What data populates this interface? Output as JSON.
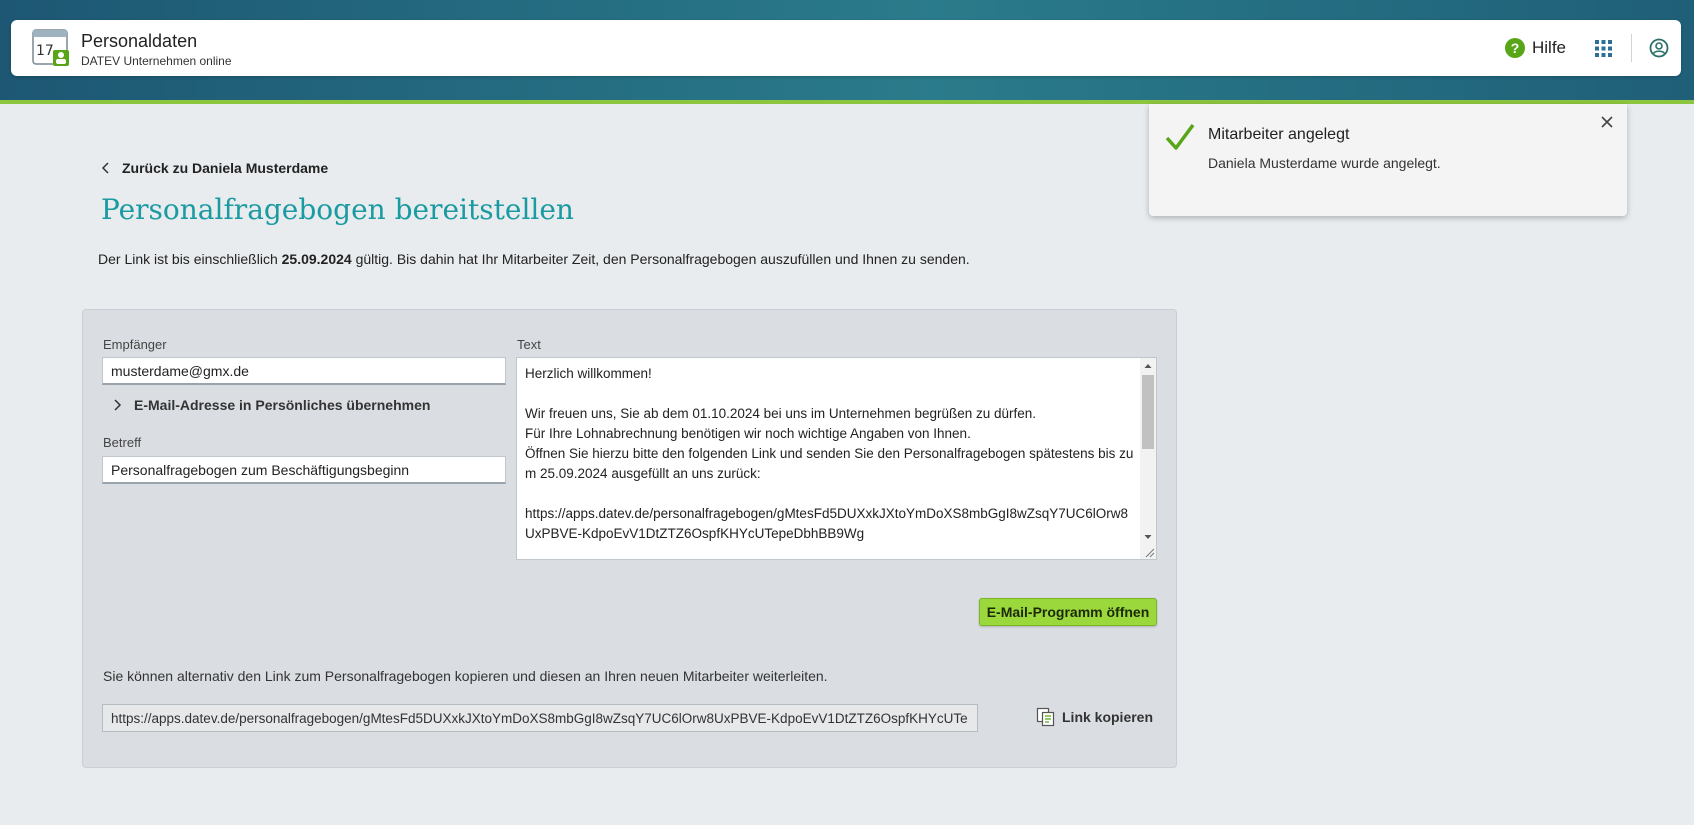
{
  "app": {
    "title": "Personaldaten",
    "subtitle": "DATEV Unternehmen online",
    "icon": "calendar-17-icon"
  },
  "header": {
    "help_label": "Hilfe",
    "help_icon_glyph": "?",
    "apps_icon": "grid-icon",
    "user_icon": "user-icon"
  },
  "toast": {
    "title": "Mitarbeiter angelegt",
    "message": "Daniela Musterdame wurde angelegt.",
    "icon": "check-icon",
    "close_icon": "close-icon"
  },
  "nav": {
    "back_label": "Zurück zu Daniela Musterdame"
  },
  "page": {
    "title": "Personalfragebogen bereitstellen",
    "info_prefix": "Der Link ist bis einschließlich ",
    "info_date": "25.09.2024",
    "info_suffix": " gültig. Bis dahin hat Ihr Mitarbeiter Zeit, den Personalfragebogen auszufüllen und Ihnen zu senden."
  },
  "form": {
    "recipient_label": "Empfänger",
    "recipient_value": "musterdame@gmx.de",
    "adopt_email_label": "E-Mail-Adresse in Persönliches übernehmen",
    "subject_label": "Betreff",
    "subject_value": "Personalfragebogen zum Beschäftigungsbeginn",
    "text_label": "Text",
    "text_value": "Herzlich willkommen!\n\nWir freuen uns, Sie ab dem 01.10.2024 bei uns im Unternehmen begrüßen zu dürfen.\nFür Ihre Lohnabrechnung benötigen wir noch wichtige Angaben von Ihnen.\nÖffnen Sie hierzu bitte den folgenden Link und senden Sie den Personalfragebogen spätestens bis zum 25.09.2024 ausgefüllt an uns zurück:\n\nhttps://apps.datev.de/personalfragebogen/gMtesFd5DUXxkJXtoYmDoXS8mbGgI8wZsqY7UC6lOrw8UxPBVE-KdpoEvV1DtZTZ6OspfKHYcUTepeDbhBB9Wg",
    "open_mail_button": "E-Mail-Programm öffnen",
    "alt_text": "Sie können alternativ den Link zum Personalfragebogen kopieren und diesen an Ihren neuen Mitarbeiter weiterleiten.",
    "link_value": "https://apps.datev.de/personalfragebogen/gMtesFd5DUXxkJXtoYmDoXS8mbGgI8wZsqY7UC6lOrw8UxPBVE-KdpoEvV1DtZTZ6OspfKHYcUTe",
    "copy_link_label": "Link kopieren"
  },
  "colors": {
    "accent_teal": "#1a9aa1",
    "primary_green": "#9bd83c",
    "header_gradient_start": "#1d5773",
    "header_gradient_end": "#2a7b8b",
    "success_green": "#58a618"
  }
}
